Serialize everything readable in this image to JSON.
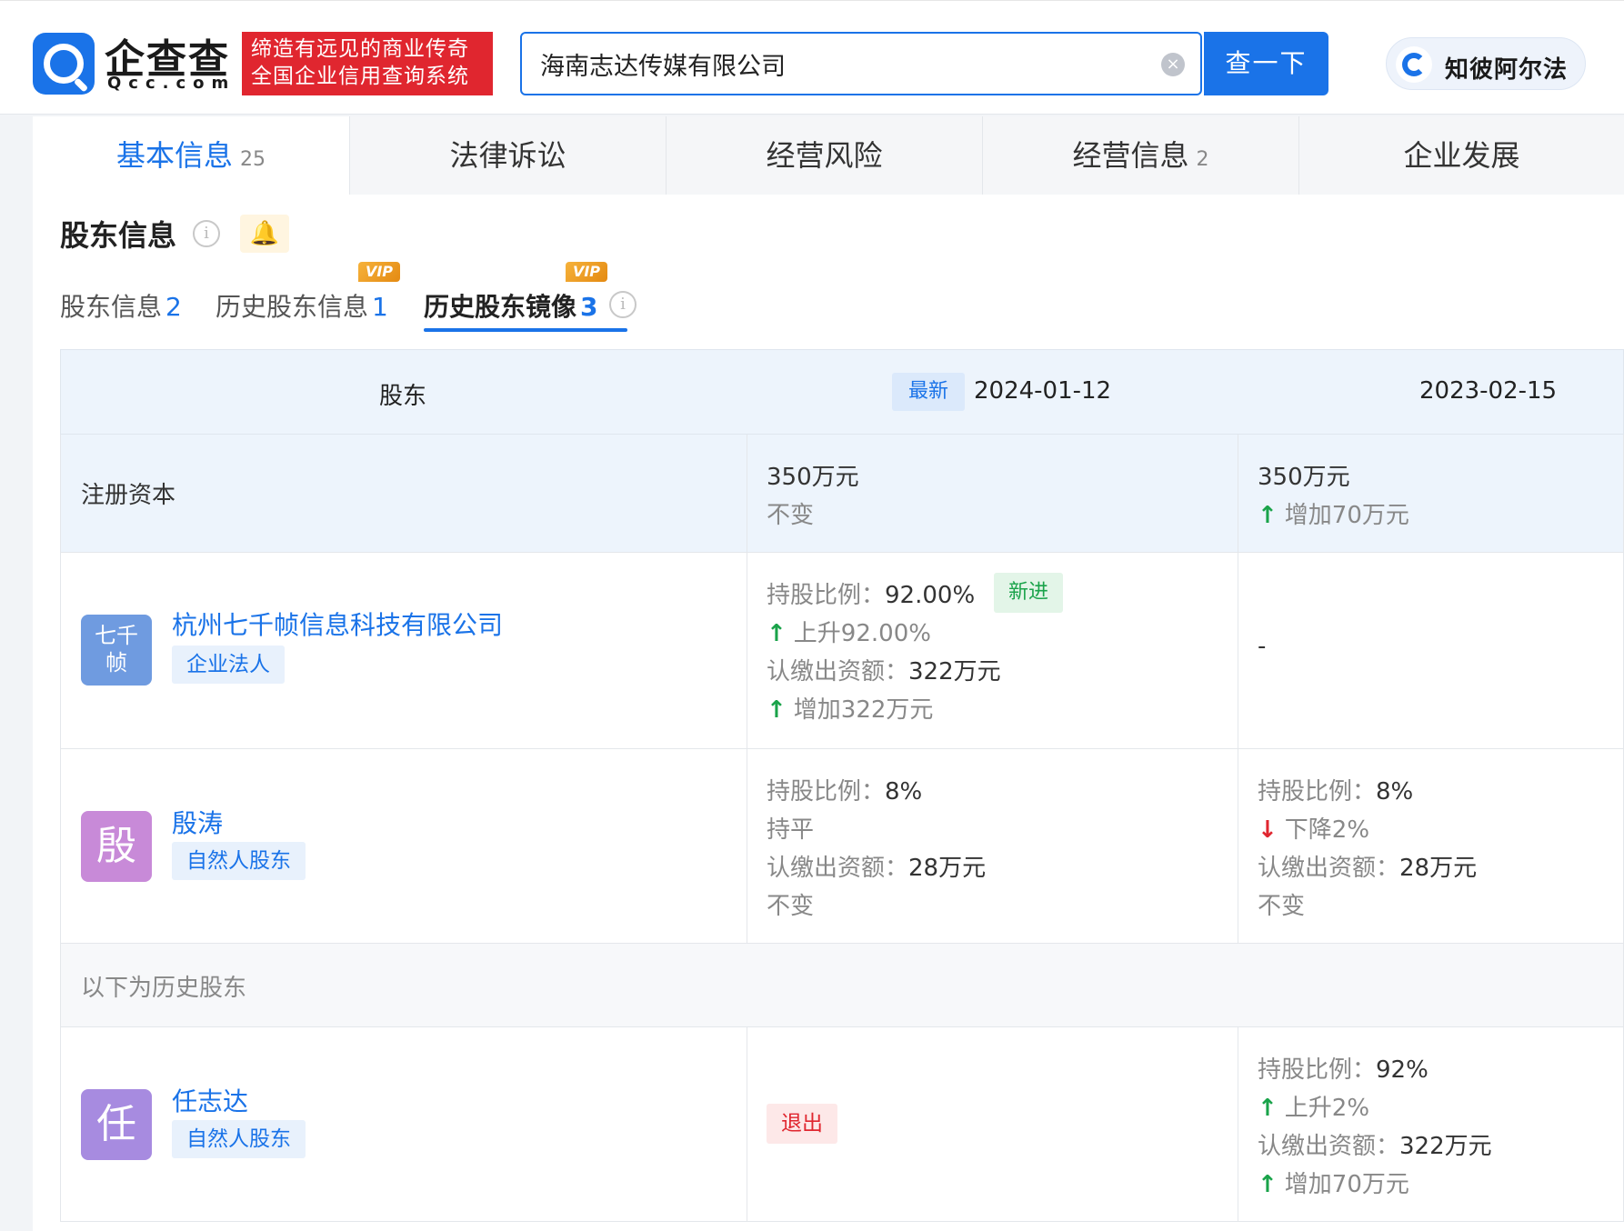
{
  "header": {
    "logo_name": "企查查",
    "logo_domain": "Qcc.com",
    "slogan_line1": "缔造有远见的商业传奇",
    "slogan_line2": "全国企业信用查询系统",
    "search_value": "海南志达传媒有限公司",
    "search_button": "查一下",
    "partner_label": "知彼阿尔法",
    "brand_color": "#1a73e8",
    "slogan_color": "#e0262f"
  },
  "tabs": [
    {
      "label": "基本信息",
      "count": "25"
    },
    {
      "label": "法律诉讼",
      "count": ""
    },
    {
      "label": "经营风险",
      "count": ""
    },
    {
      "label": "经营信息",
      "count": "2"
    },
    {
      "label": "企业发展",
      "count": ""
    }
  ],
  "section": {
    "title": "股东信息",
    "info_icon": "i",
    "bell_icon": "🔔"
  },
  "subtabs": [
    {
      "label": "股东信息",
      "count": "2",
      "vip": false
    },
    {
      "label": "历史股东信息",
      "count": "1",
      "vip": true
    },
    {
      "label": "历史股东镜像",
      "count": "3",
      "vip": true
    }
  ],
  "vip_label": "VIP",
  "table": {
    "header_shareholder": "股东",
    "latest_tag": "最新",
    "date_latest": "2024-01-12",
    "date_prev": "2023-02-15",
    "capital": {
      "label": "注册资本",
      "latest_value": "350万元",
      "latest_change": "不变",
      "prev_value": "350万元",
      "prev_change": "增加70万元"
    },
    "rows": [
      {
        "avatar_text": "七千帧",
        "avatar_line1": "七千",
        "avatar_line2": "帧",
        "avatar_color": "#6f9be0",
        "name": "杭州七千帧信息科技有限公司",
        "type": "企业法人",
        "latest": {
          "ratio_label": "持股比例：",
          "ratio": "92.00%",
          "badge": "新进",
          "ratio_change": "上升92.00%",
          "amount_label": "认缴出资额：",
          "amount": "322万元",
          "amount_change": "增加322万元"
        },
        "prev_empty": "-"
      },
      {
        "avatar_text": "殷",
        "avatar_color": "#c88ad8",
        "name": "殷涛",
        "type": "自然人股东",
        "latest": {
          "ratio_label": "持股比例：",
          "ratio": "8%",
          "ratio_change": "持平",
          "amount_label": "认缴出资额：",
          "amount": "28万元",
          "amount_change": "不变"
        },
        "prev": {
          "ratio_label": "持股比例：",
          "ratio": "8%",
          "ratio_change": "下降2%",
          "amount_label": "认缴出资额：",
          "amount": "28万元",
          "amount_change": "不变"
        }
      }
    ],
    "history_label": "以下为历史股东",
    "history_rows": [
      {
        "avatar_text": "任",
        "avatar_color": "#a78be0",
        "name": "任志达",
        "type": "自然人股东",
        "latest_status": "退出",
        "prev": {
          "ratio_label": "持股比例：",
          "ratio": "92%",
          "ratio_change": "上升2%",
          "amount_label": "认缴出资额：",
          "amount": "322万元",
          "amount_change": "增加70万元"
        }
      }
    ]
  }
}
